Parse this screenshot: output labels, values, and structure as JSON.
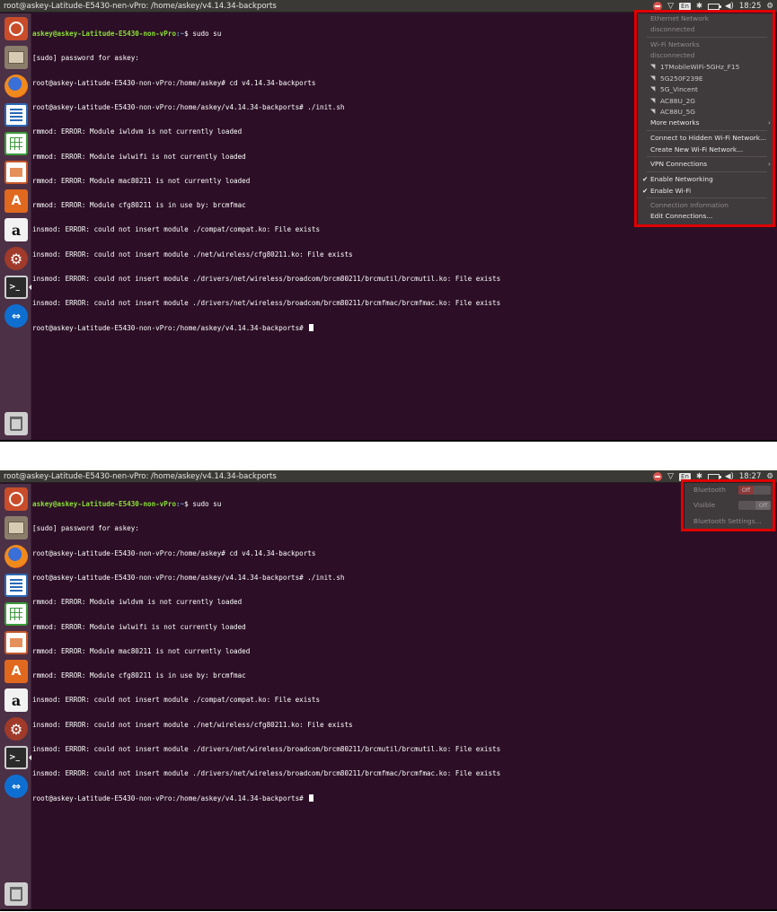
{
  "window_title": "root@askey-Latitude-E5430-nen-vPro: /home/askey/v4.14.34-backports",
  "tray": {
    "keyboard_layout": "En",
    "time_1": "18:25",
    "time_2": "18:27"
  },
  "terminal": {
    "lines": [
      {
        "user": "askey@askey-Latitude-E5430-non-vPro",
        "path": ":~",
        "text": "$ sudo su"
      },
      {
        "text": "[sudo] password for askey:"
      },
      {
        "text": "root@askey-Latitude-E5430-non-vPro:/home/askey# cd v4.14.34-backports"
      },
      {
        "text": "root@askey-Latitude-E5430-non-vPro:/home/askey/v4.14.34-backports# ./init.sh"
      },
      {
        "text": "rmmod: ERROR: Module iwldvm is not currently loaded"
      },
      {
        "text": "rmmod: ERROR: Module iwlwifi is not currently loaded"
      },
      {
        "text": "rmmod: ERROR: Module mac80211 is not currently loaded"
      },
      {
        "text": "rmmod: ERROR: Module cfg80211 is in use by: brcmfmac"
      },
      {
        "text": "insmod: ERROR: could not insert module ./compat/compat.ko: File exists"
      },
      {
        "text": "insmod: ERROR: could not insert module ./net/wireless/cfg80211.ko: File exists"
      },
      {
        "text": "insmod: ERROR: could not insert module ./drivers/net/wireless/broadcom/brcm80211/brcmutil/brcmutil.ko: File exists"
      },
      {
        "text": "insmod: ERROR: could not insert module ./drivers/net/wireless/broadcom/brcm80211/brcmfmac/brcmfmac.ko: File exists"
      },
      {
        "text": "root@askey-Latitude-E5430-non-vPro:/home/askey/v4.14.34-backports# ",
        "cursor": true
      }
    ]
  },
  "network_menu": {
    "ethernet_header": "Ethernet Network",
    "ethernet_status": "disconnected",
    "wifi_header": "Wi-Fi Networks",
    "wifi_status": "disconnected",
    "networks": [
      "1TMobileWiFi-5GHz_F15",
      "5G250F239E",
      "5G_Vincent",
      "AC88U_2G",
      "AC88U_5G"
    ],
    "more_networks": "More networks",
    "connect_hidden": "Connect to Hidden Wi-Fi Network...",
    "create_new": "Create New Wi-Fi Network...",
    "vpn": "VPN Connections",
    "enable_networking": "Enable Networking",
    "enable_wifi": "Enable Wi-Fi",
    "connection_info": "Connection Information",
    "edit_connections": "Edit Connections..."
  },
  "bluetooth_menu": {
    "bluetooth_label": "Bluetooth",
    "bluetooth_state": "Off",
    "visible_label": "Visible",
    "visible_state": "Off",
    "settings": "Bluetooth Settings..."
  },
  "colors": {
    "terminal_bg": "#2c0f26",
    "highlight": "#e00000",
    "prompt_user": "#8ae234",
    "prompt_path": "#729fcf"
  }
}
